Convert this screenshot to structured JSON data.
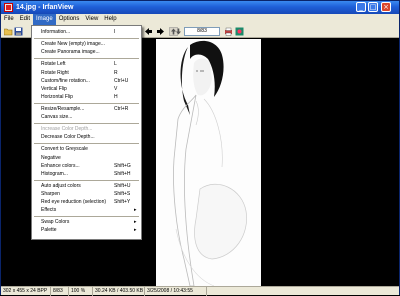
{
  "window": {
    "title": "14.jpg - IrfanView",
    "min_glyph": "_",
    "max_glyph": "□",
    "close_glyph": "×"
  },
  "menubar": {
    "items": [
      "File",
      "Edit",
      "Image",
      "Options",
      "View",
      "Help"
    ],
    "active": "Image"
  },
  "toolbar": {
    "page_counter": "8/83",
    "icons": [
      "open-folder-icon",
      "save-icon",
      "copy-icon",
      "arrow-left-icon",
      "arrow-right-icon",
      "info-icon",
      "print-icon"
    ]
  },
  "image_menu": {
    "items": [
      {
        "label": "Information...",
        "shortcut": "I",
        "disabled": false
      },
      {
        "sep": true
      },
      {
        "label": "Create New (empty) image...",
        "shortcut": "",
        "disabled": false
      },
      {
        "label": "Create Panorama image...",
        "shortcut": "",
        "disabled": false
      },
      {
        "sep": true
      },
      {
        "label": "Rotate Left",
        "shortcut": "L",
        "disabled": false
      },
      {
        "label": "Rotate Right",
        "shortcut": "R",
        "disabled": false
      },
      {
        "label": "Custom/fine rotation...",
        "shortcut": "Ctrl+U",
        "disabled": false
      },
      {
        "label": "Vertical Flip",
        "shortcut": "V",
        "disabled": false
      },
      {
        "label": "Horizontal Flip",
        "shortcut": "H",
        "disabled": false
      },
      {
        "sep": true
      },
      {
        "label": "Resize/Resample...",
        "shortcut": "Ctrl+R",
        "disabled": false
      },
      {
        "label": "Canvas size...",
        "shortcut": "",
        "disabled": false
      },
      {
        "sep": true
      },
      {
        "label": "Increase Color Depth...",
        "shortcut": "",
        "disabled": true
      },
      {
        "label": "Decrease Color Depth...",
        "shortcut": "",
        "disabled": false
      },
      {
        "sep": true
      },
      {
        "label": "Convert to Greyscale",
        "shortcut": "",
        "disabled": false
      },
      {
        "label": "Negative",
        "shortcut": "",
        "disabled": false
      },
      {
        "label": "Enhance colors...",
        "shortcut": "Shift+G",
        "disabled": false
      },
      {
        "label": "Histogram...",
        "shortcut": "Shift+H",
        "disabled": false
      },
      {
        "sep": true
      },
      {
        "label": "Auto adjust colors",
        "shortcut": "Shift+U",
        "disabled": false
      },
      {
        "label": "Sharpen",
        "shortcut": "Shift+S",
        "disabled": false
      },
      {
        "label": "Red eye reduction (selection)",
        "shortcut": "Shift+Y",
        "disabled": false
      },
      {
        "label": "Effects",
        "shortcut": "",
        "disabled": false,
        "submenu": true
      },
      {
        "sep": true
      },
      {
        "label": "Swap Colors",
        "shortcut": "",
        "disabled": false,
        "submenu": true
      },
      {
        "label": "Palette",
        "shortcut": "",
        "disabled": false,
        "submenu": true
      }
    ]
  },
  "statusbar": {
    "cells": [
      "302 x 455 x 24 BPP",
      "8/83",
      "100 %",
      "30.24 KB / 403.50 KB",
      "3/25/2008 / 10:43:55"
    ]
  },
  "colors": {
    "titlebar": "#1f5fd8",
    "menu_highlight": "#316ac5",
    "chrome": "#ece9d8"
  }
}
